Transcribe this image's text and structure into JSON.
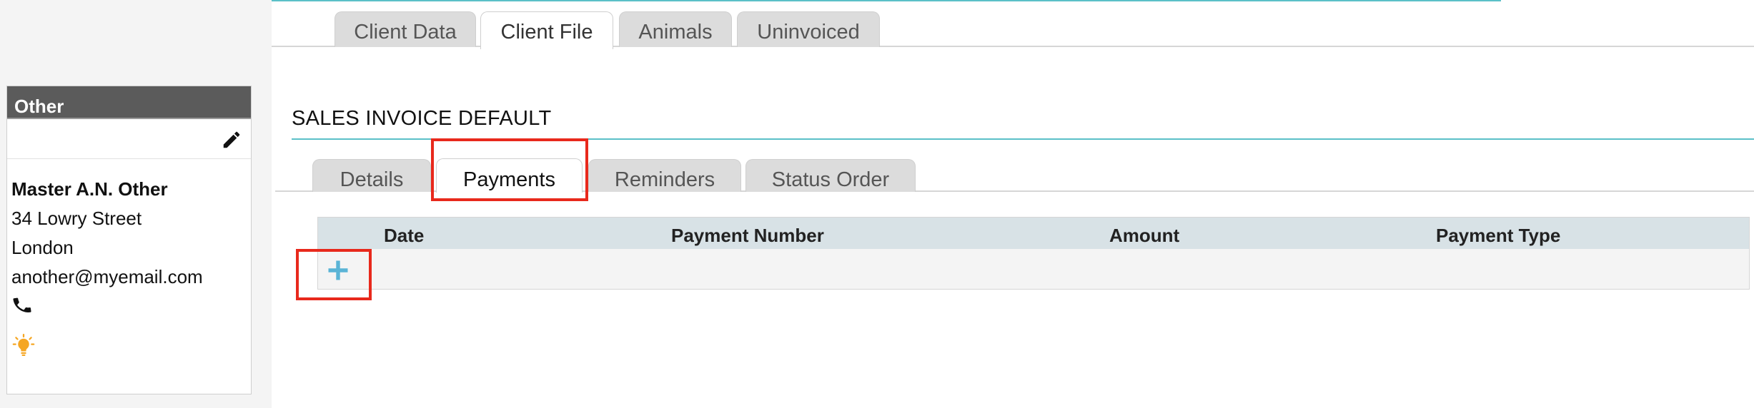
{
  "top_tabs": [
    {
      "label": "Client Data",
      "active": false
    },
    {
      "label": "Client File",
      "active": true
    },
    {
      "label": "Animals",
      "active": false
    },
    {
      "label": "Uninvoiced",
      "active": false
    }
  ],
  "client_card": {
    "header": "Other",
    "name": "Master A.N. Other",
    "address_line1": "34 Lowry Street",
    "address_line2": "London",
    "email": "another@myemail.com"
  },
  "section": {
    "title": "SALES INVOICE DEFAULT"
  },
  "sub_tabs": [
    {
      "label": "Details",
      "active": false
    },
    {
      "label": "Payments",
      "active": true
    },
    {
      "label": "Reminders",
      "active": false
    },
    {
      "label": "Status Order",
      "active": false
    }
  ],
  "payments_table": {
    "columns": [
      "Date",
      "Payment Number",
      "Amount",
      "Payment Type"
    ],
    "rows": []
  },
  "colors": {
    "accent": "#5bc0c8",
    "highlight": "#e8291c",
    "add_icon": "#5ab4d6",
    "bulb_icon": "#f5a623"
  },
  "icons": [
    "pencil-icon",
    "phone-icon",
    "lightbulb-icon",
    "plus-icon"
  ]
}
